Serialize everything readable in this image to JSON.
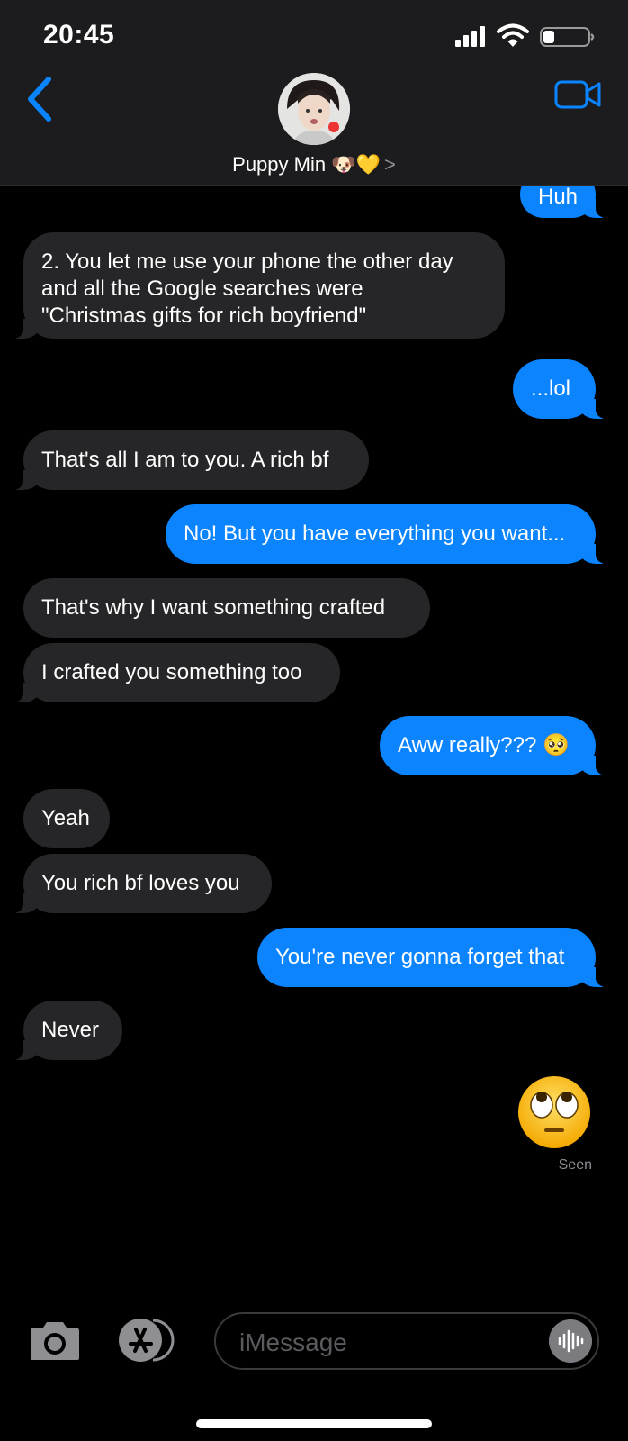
{
  "status": {
    "time": "20:45"
  },
  "contact": {
    "name": "Puppy Min 🐶💛",
    "chevron": ">"
  },
  "messages": [
    {
      "from": "me",
      "text": "Huh"
    },
    {
      "from": "them",
      "text": "2. You let me use your phone the other day\nand all the Google searches were\n\"Christmas gifts for rich boyfriend\""
    },
    {
      "from": "me",
      "text": "...lol"
    },
    {
      "from": "them",
      "text": "That's all I am to you. A rich bf"
    },
    {
      "from": "me",
      "text": "No! But you have everything you want..."
    },
    {
      "from": "them",
      "text": "That's why I want something crafted"
    },
    {
      "from": "them",
      "text": "I crafted you something too"
    },
    {
      "from": "me",
      "text": "Aww really??? 🥺"
    },
    {
      "from": "them",
      "text": "Yeah"
    },
    {
      "from": "them",
      "text": "You rich bf loves you"
    },
    {
      "from": "me",
      "text": "You're never gonna forget that"
    },
    {
      "from": "them",
      "text": "Never"
    },
    {
      "from": "me",
      "text": "🙄"
    }
  ],
  "receipt": "Seen",
  "composer": {
    "placeholder": "iMessage"
  },
  "icons": {
    "back": "chevron-left-icon",
    "video": "video-camera-icon",
    "camera": "camera-icon",
    "apps": "app-store-icon",
    "audio": "audio-waveform-icon"
  },
  "colors": {
    "outgoing": "#0b84fe",
    "incoming": "#262628",
    "accent": "#0a84ff"
  }
}
